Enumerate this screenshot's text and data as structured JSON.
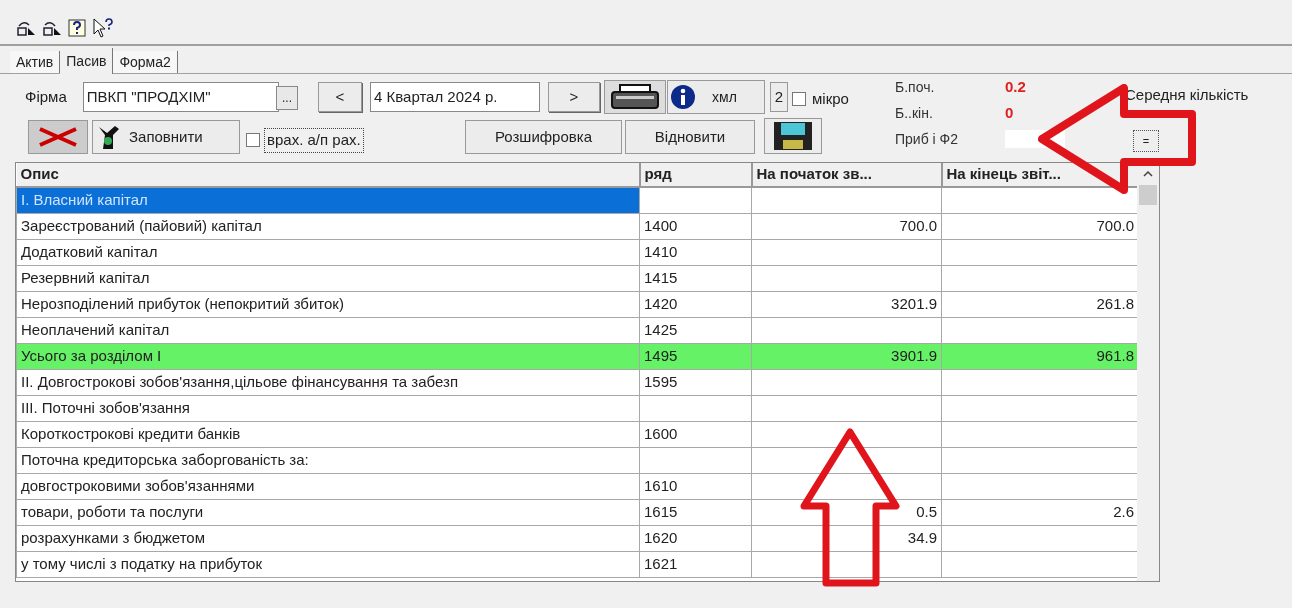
{
  "tabs": [
    {
      "label": "Актив",
      "selected": false
    },
    {
      "label": "Пасив",
      "selected": true
    },
    {
      "label": "Форма2",
      "selected": false
    }
  ],
  "firm": {
    "label": "Фірма",
    "value": "ПВКП \"ПРОДХІМ\"",
    "browse": "..."
  },
  "period": {
    "prev": "<",
    "value": "4 Квартал 2024 р.",
    "next": ">"
  },
  "xml_button": "хмл",
  "two_button": "2",
  "micro": {
    "label": "мікро",
    "checked": false
  },
  "fill_button": "Заповнити",
  "account": {
    "label": "врах. а/п рах.",
    "checked": false
  },
  "decode_button": "Розшифровка",
  "restore_button": "Відновити",
  "balance": [
    {
      "label": "Б.поч.",
      "value": "0.2"
    },
    {
      "label": "Б..кін.",
      "value": "0"
    },
    {
      "label": "Приб і Ф2"
    }
  ],
  "average_label": "Середня кількість",
  "equals_button": "=",
  "table": {
    "columns": [
      "Опис",
      "ряд",
      "На початок зв...",
      "На кінець звіт..."
    ],
    "rows": [
      {
        "cells": [
          "I. Власний капітал",
          "",
          "",
          ""
        ],
        "selected": true,
        "total": false
      },
      {
        "cells": [
          "Зареєстрований (пайовий) капітал",
          "1400",
          "700.0",
          "700.0"
        ],
        "selected": false,
        "total": false
      },
      {
        "cells": [
          "Додатковий капітал",
          "1410",
          "",
          ""
        ],
        "selected": false,
        "total": false
      },
      {
        "cells": [
          "Резервний капітал",
          "1415",
          "",
          ""
        ],
        "selected": false,
        "total": false
      },
      {
        "cells": [
          "Нерозподілений прибуток  (непокритий збиток)",
          "1420",
          "3201.9",
          "261.8"
        ],
        "selected": false,
        "total": false
      },
      {
        "cells": [
          "Неоплачений капітал",
          "1425",
          "",
          ""
        ],
        "selected": false,
        "total": false
      },
      {
        "cells": [
          "Усього за розділом I",
          "1495",
          "3901.9",
          "961.8"
        ],
        "selected": false,
        "total": true
      },
      {
        "cells": [
          "II. Довгострокові зобов'язання,цільове фінансування та забезп",
          "1595",
          "",
          ""
        ],
        "selected": false,
        "total": false
      },
      {
        "cells": [
          "III. Поточні зобов'язання",
          "",
          "",
          ""
        ],
        "selected": false,
        "total": false
      },
      {
        "cells": [
          "Короткострокові кредити банків",
          "1600",
          "",
          ""
        ],
        "selected": false,
        "total": false
      },
      {
        "cells": [
          "Поточна кредиторська заборгованість за:",
          "",
          "",
          ""
        ],
        "selected": false,
        "total": false
      },
      {
        "cells": [
          "довгостроковими зобов'язаннями",
          "1610",
          "",
          ""
        ],
        "selected": false,
        "total": false
      },
      {
        "cells": [
          "товари, роботи та послуги",
          "1615",
          "0.5",
          "2.6"
        ],
        "selected": false,
        "total": false
      },
      {
        "cells": [
          "розрахунками з бюджетом",
          "1620",
          "34.9",
          ""
        ],
        "selected": false,
        "total": false
      },
      {
        "cells": [
          "у тому числі з податку на прибуток",
          "1621",
          "",
          ""
        ],
        "selected": false,
        "total": false
      }
    ]
  }
}
